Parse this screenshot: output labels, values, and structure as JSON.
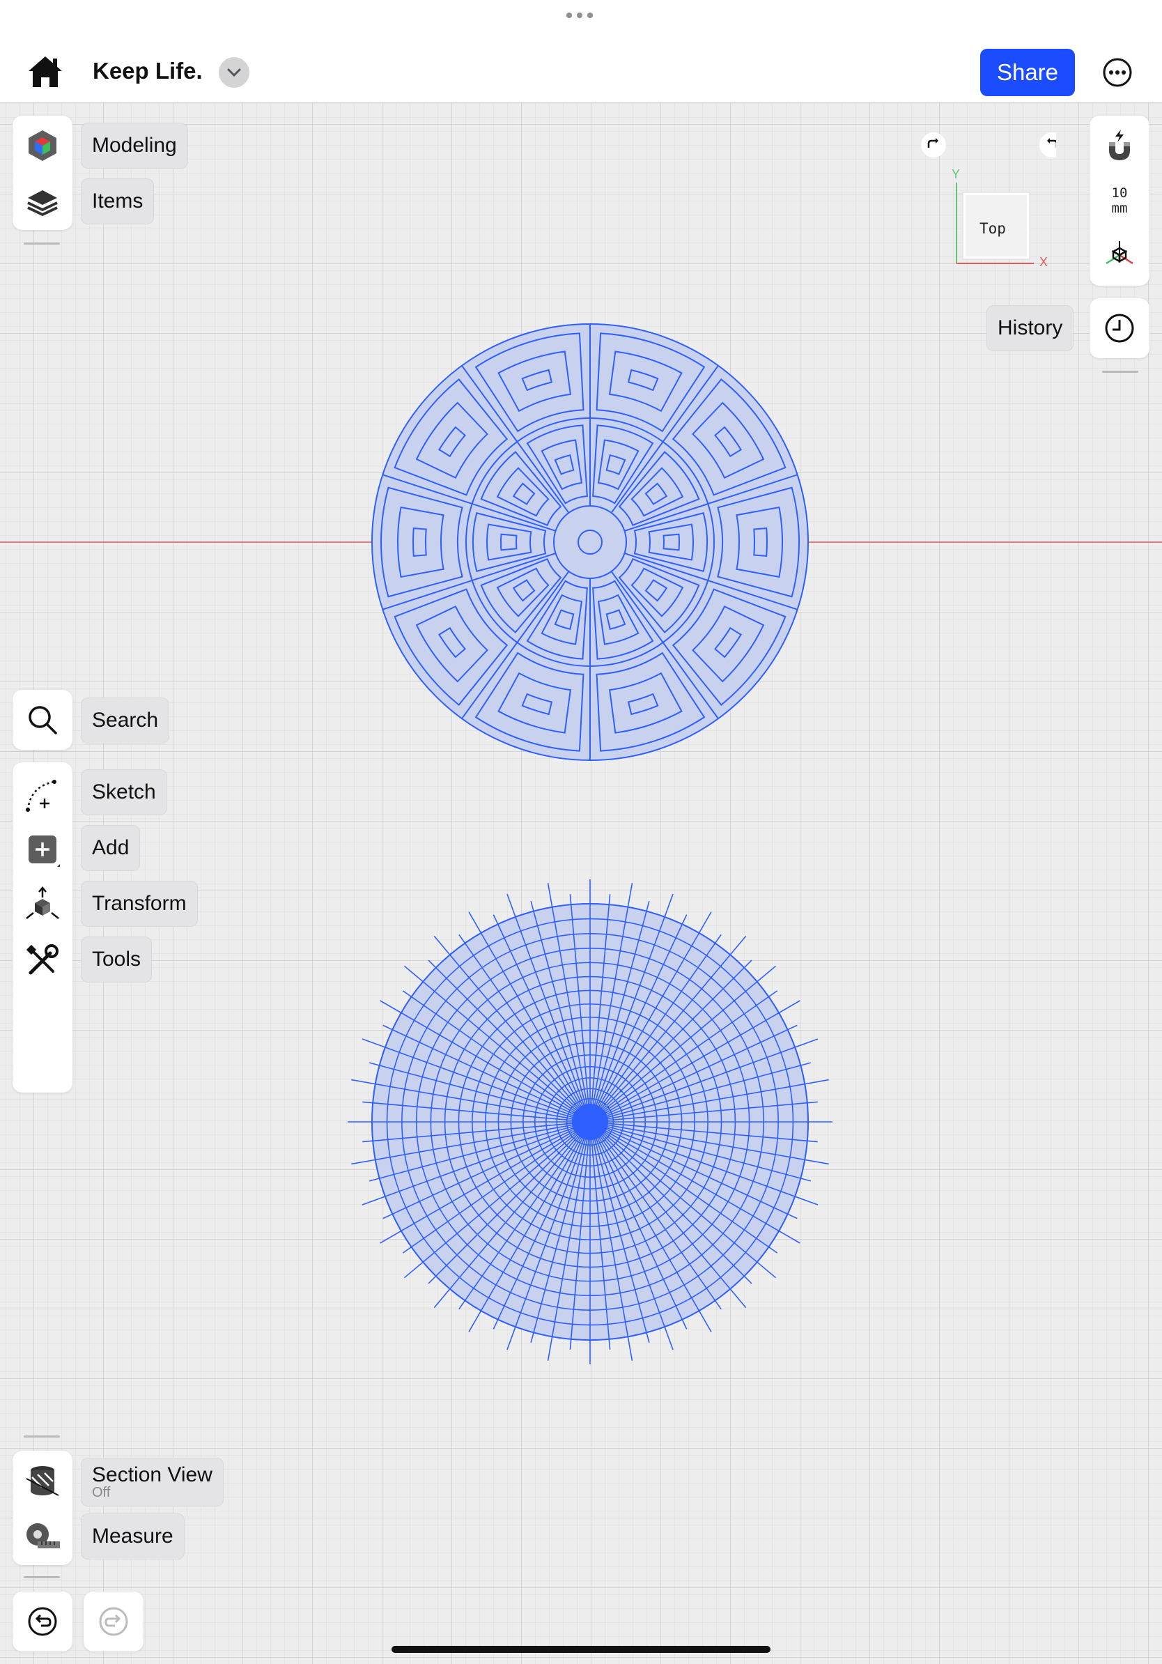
{
  "app": {
    "document_title": "Keep Life.",
    "share_label": "Share"
  },
  "left_panel_top": {
    "modeling_label": "Modeling",
    "items_label": "Items"
  },
  "left_panel_middle": {
    "search_label": "Search",
    "sketch_label": "Sketch",
    "add_label": "Add",
    "transform_label": "Transform",
    "tools_label": "Tools"
  },
  "left_panel_bottom": {
    "section_view_label": "Section View",
    "section_view_state": "Off",
    "measure_label": "Measure"
  },
  "right_panel": {
    "grid_value": "10",
    "grid_unit": "mm",
    "history_label": "History"
  },
  "view_cube": {
    "face_label": "Top",
    "axis_x": "X",
    "axis_y": "Y"
  },
  "colors": {
    "accent": "#1b4dff",
    "sketch_line": "#2f5fff",
    "sketch_fill": "#c8d2ee",
    "axis_x": "#e25b5b",
    "axis_y": "#5fc47a",
    "grid_minor": "#dcdcdc",
    "grid_major": "#cfcfcf"
  }
}
